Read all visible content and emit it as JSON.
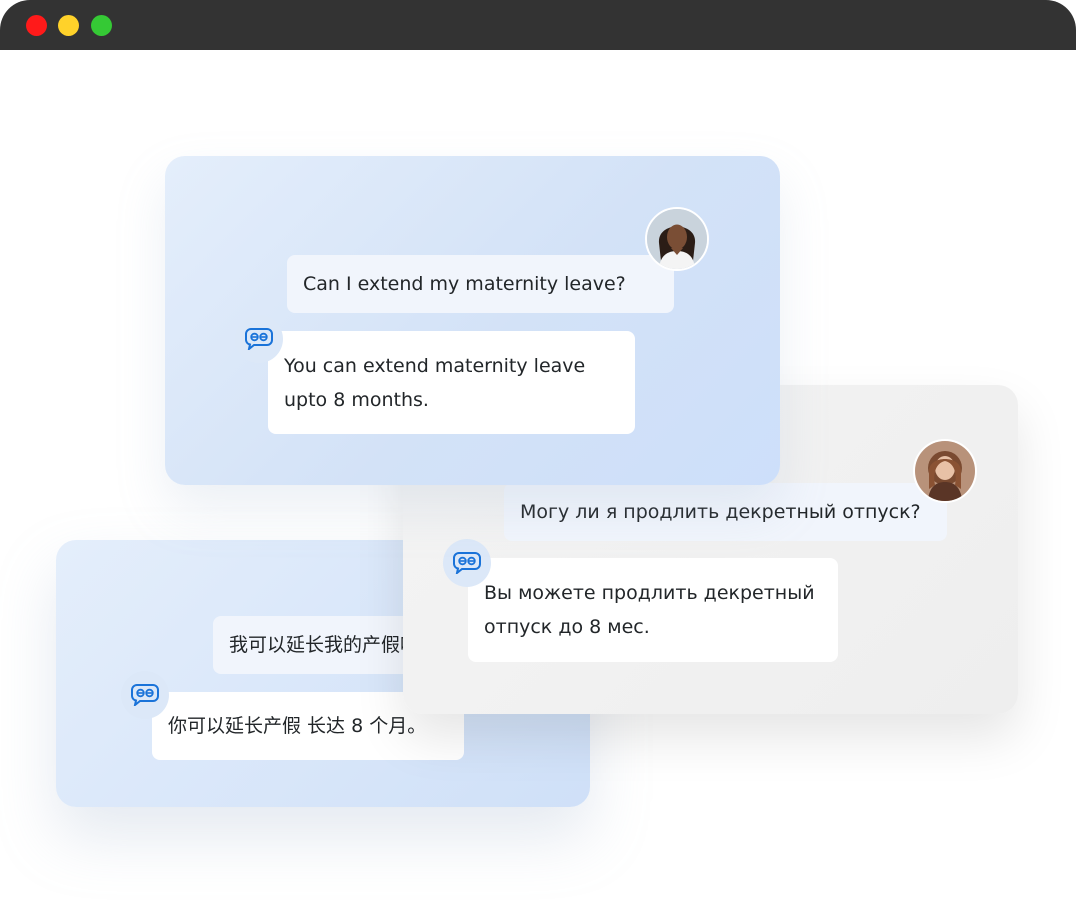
{
  "window": {
    "controls": [
      "close",
      "minimize",
      "maximize"
    ],
    "colors": {
      "titlebar": "#333333",
      "close": "#ff1a1a",
      "minimize": "#ffd22a",
      "maximize": "#35c935"
    }
  },
  "chats": {
    "english": {
      "question": "Can I extend my maternity leave?",
      "answer_line1": "You can extend maternity leave",
      "answer_line2": "upto 8 months."
    },
    "russian": {
      "question": "Могу ли я продлить декретный отпуск?",
      "answer_line1": "Вы можете продлить декретный",
      "answer_line2": "отпуск до 8 мес."
    },
    "chinese": {
      "question": "我可以延长我的产假吗?",
      "answer": "你可以延长产假 长达 8 个月。"
    }
  },
  "icons": {
    "bot": "chat-bubble-bot-icon",
    "user_avatar": "user-avatar"
  },
  "accent_color": "#1a73d9"
}
